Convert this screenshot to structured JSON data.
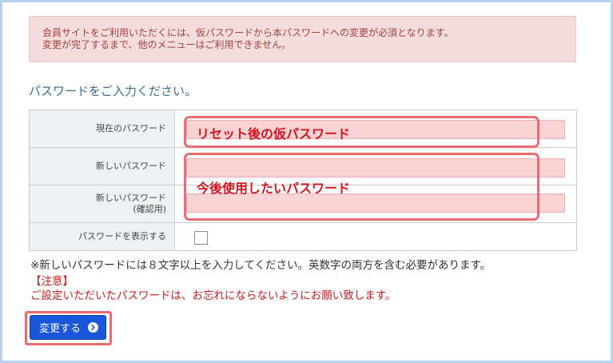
{
  "alert": {
    "line1": "会員サイトをご利用いただくには、仮パスワードから本パスワードへの変更が必須となります。",
    "line2": "変更が完了するまで、他のメニューはご利用できません。"
  },
  "form": {
    "prompt": "パスワードをご入力ください。",
    "rows": [
      {
        "label": "現在のパスワード"
      },
      {
        "label": "新しいパスワード"
      },
      {
        "label": "新しいパスワード",
        "sublabel": "(確認用)"
      },
      {
        "label": "パスワードを表示する"
      }
    ]
  },
  "annotations": {
    "current": "リセット後の仮パスワード",
    "new": "今後使用したいパスワード"
  },
  "notes": {
    "requirement": "※新しいパスワードには８文字以上を入力してください。英数字の両方を含む必要があります。",
    "attention_label": "【注意】",
    "attention_text": "ご設定いただいたパスワードは、お忘れにならないようにお願い致します。"
  },
  "submit": {
    "label": "変更する"
  },
  "colors": {
    "primary": "#1a56db",
    "highlight": "#ec6b70",
    "alert_bg": "#f4dcdd",
    "warning_text": "#cc1f1f"
  }
}
